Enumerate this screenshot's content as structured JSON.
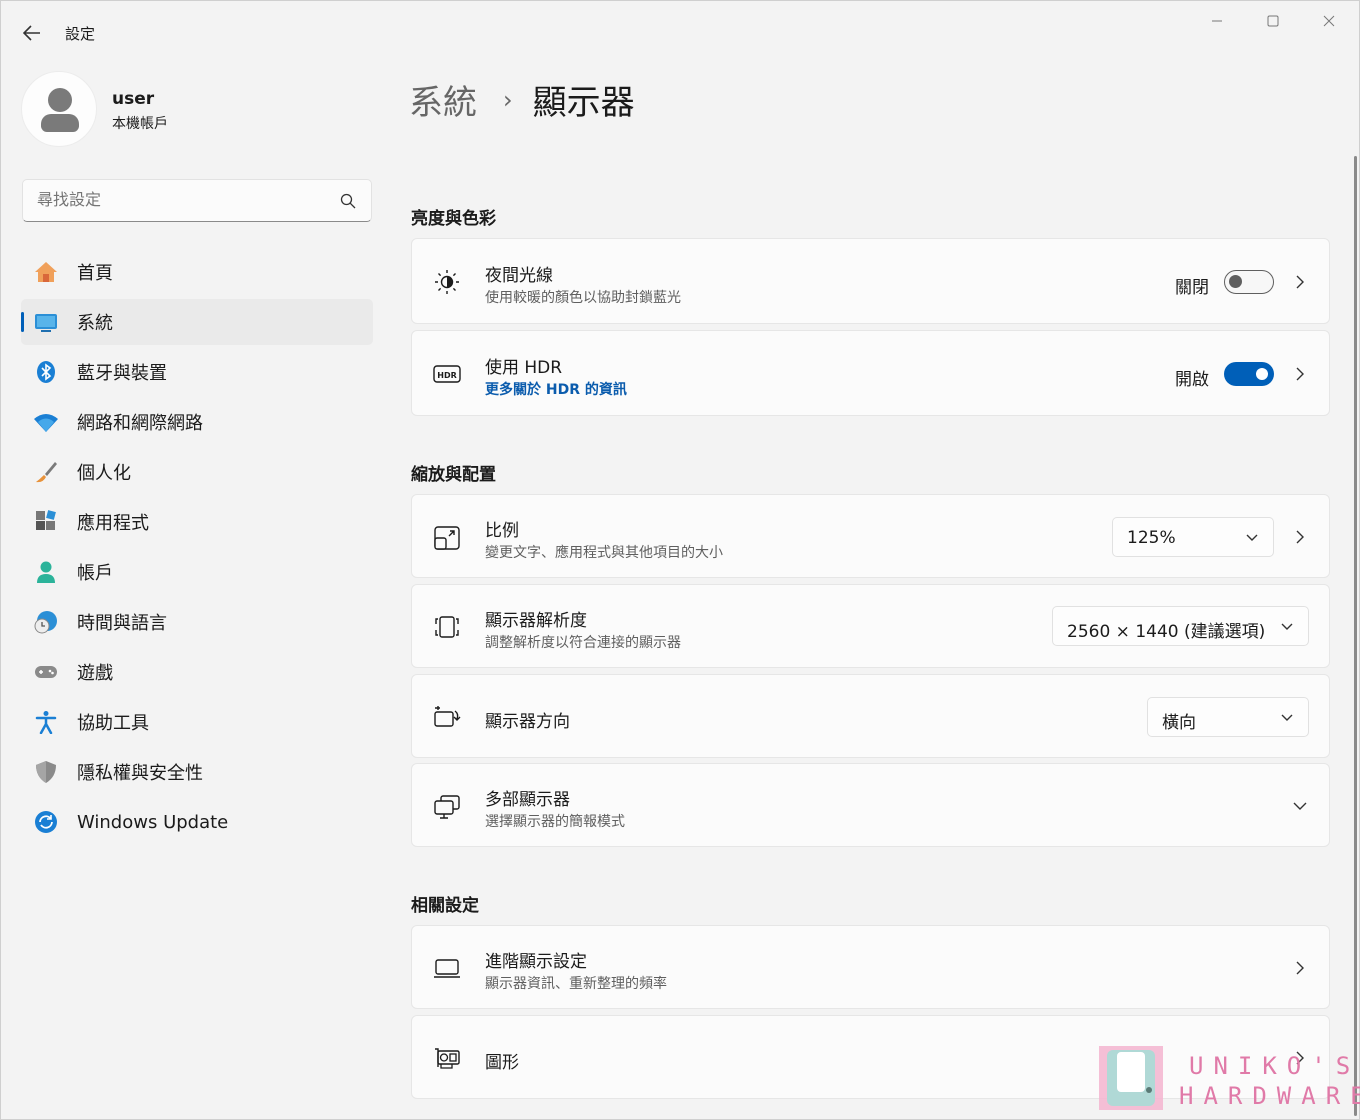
{
  "window": {
    "title": "設定",
    "controls": {
      "minimize": "—",
      "maximize": "☐",
      "close": "✕"
    }
  },
  "account": {
    "name": "user",
    "type": "本機帳戶"
  },
  "search": {
    "placeholder": "尋找設定"
  },
  "sidebar": {
    "items": [
      {
        "label": "首頁",
        "icon": "home-icon",
        "active": false
      },
      {
        "label": "系統",
        "icon": "system-icon",
        "active": true
      },
      {
        "label": "藍牙與裝置",
        "icon": "bluetooth-icon",
        "active": false
      },
      {
        "label": "網路和網際網路",
        "icon": "wifi-icon",
        "active": false
      },
      {
        "label": "個人化",
        "icon": "brush-icon",
        "active": false
      },
      {
        "label": "應用程式",
        "icon": "apps-icon",
        "active": false
      },
      {
        "label": "帳戶",
        "icon": "accounts-icon",
        "active": false
      },
      {
        "label": "時間與語言",
        "icon": "globe-clock-icon",
        "active": false
      },
      {
        "label": "遊戲",
        "icon": "gamepad-icon",
        "active": false
      },
      {
        "label": "協助工具",
        "icon": "accessibility-icon",
        "active": false
      },
      {
        "label": "隱私權與安全性",
        "icon": "shield-icon",
        "active": false
      },
      {
        "label": "Windows Update",
        "icon": "update-icon",
        "active": false
      }
    ]
  },
  "breadcrumb": {
    "parent": "系統",
    "separator": "›",
    "current": "顯示器"
  },
  "sections": {
    "brightness": {
      "title": "亮度與色彩",
      "night_light": {
        "title": "夜間光線",
        "subtitle": "使用較暖的顏色以協助封鎖藍光",
        "state": "關閉",
        "on": false
      },
      "hdr": {
        "title": "使用 HDR",
        "link": "更多關於 HDR 的資訊",
        "state": "開啟",
        "on": true
      }
    },
    "scale_layout": {
      "title": "縮放與配置",
      "scale": {
        "title": "比例",
        "subtitle": "變更文字、應用程式與其他項目的大小",
        "value": "125%"
      },
      "resolution": {
        "title": "顯示器解析度",
        "subtitle": "調整解析度以符合連接的顯示器",
        "value": "2560 × 1440 (建議選項)"
      },
      "orientation": {
        "title": "顯示器方向",
        "value": "橫向"
      },
      "multiple": {
        "title": "多部顯示器",
        "subtitle": "選擇顯示器的簡報模式"
      }
    },
    "related": {
      "title": "相關設定",
      "advanced": {
        "title": "進階顯示設定",
        "subtitle": "顯示器資訊、重新整理的頻率"
      },
      "graphics": {
        "title": "圖形"
      }
    }
  },
  "watermark": {
    "top": "UNIKO'S",
    "bottom": "HARDWARE"
  },
  "colors": {
    "accent": "#005fb8",
    "link": "#0b5cad",
    "watermark": "#e07aa8"
  }
}
